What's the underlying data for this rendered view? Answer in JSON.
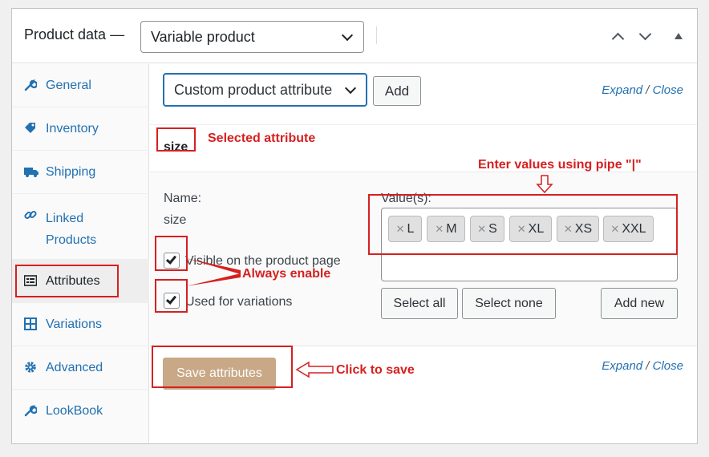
{
  "header": {
    "title": "Product data —",
    "product_type": "Variable product"
  },
  "sidebar": {
    "items": [
      {
        "label": "General",
        "icon": "wrench-icon"
      },
      {
        "label": "Inventory",
        "icon": "tag-icon"
      },
      {
        "label": "Shipping",
        "icon": "truck-icon"
      },
      {
        "label": "Linked Products",
        "icon": "link-icon"
      },
      {
        "label": "Attributes",
        "icon": "list-icon"
      },
      {
        "label": "Variations",
        "icon": "grid-icon"
      },
      {
        "label": "Advanced",
        "icon": "gear-icon"
      },
      {
        "label": "LookBook",
        "icon": "wrench-icon"
      }
    ],
    "active": "Attributes"
  },
  "toolbar": {
    "attribute_select": "Custom product attribute",
    "add_label": "Add",
    "expand": "Expand",
    "slash": " / ",
    "close": "Close"
  },
  "attribute": {
    "name_heading": "size",
    "name_label": "Name:",
    "name_value": "size",
    "values_label": "Value(s):",
    "values": [
      "L",
      "M",
      "S",
      "XL",
      "XS",
      "XXL"
    ],
    "visible_label": "Visible on the product page",
    "visible_checked": true,
    "variations_label": "Used for variations",
    "variations_checked": true,
    "select_all": "Select all",
    "select_none": "Select none",
    "add_new": "Add new"
  },
  "footer": {
    "save_label": "Save attributes",
    "expand": "Expand",
    "slash": " / ",
    "close": "Close"
  },
  "annotations": {
    "selected": "Selected attribute",
    "pipe": "Enter values using pipe \"|\"",
    "always": "Always enable",
    "save": "Click to save"
  },
  "colors": {
    "accent": "#2271b1",
    "annotation": "#d62020",
    "save_button": "#c8a886"
  }
}
